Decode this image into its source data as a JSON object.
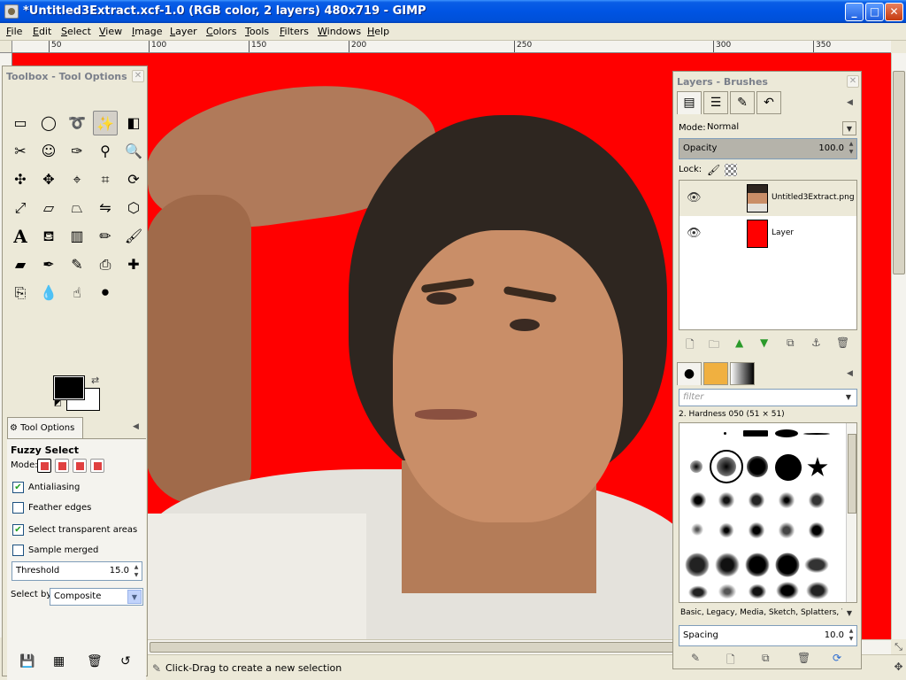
{
  "window": {
    "title": "*Untitled3Extract.xcf-1.0 (RGB color, 2 layers) 480x719 - GIMP",
    "minimize": "_",
    "maximize": "□",
    "close": "✕"
  },
  "menu": [
    "File",
    "Edit",
    "Select",
    "View",
    "Image",
    "Layer",
    "Colors",
    "Tools",
    "Filters",
    "Windows",
    "Help"
  ],
  "ruler": {
    "labels": [
      "50",
      "100",
      "150",
      "200",
      "250",
      "300",
      "350"
    ]
  },
  "status": {
    "message": "Click-Drag to create a new selection"
  },
  "toolbox": {
    "title": "Toolbox - Tool Options",
    "tool_options_tab": "Tool Options",
    "tool_heading": "Fuzzy Select",
    "mode_label": "Mode:",
    "options": [
      {
        "label": "Antialiasing",
        "checked": true
      },
      {
        "label": "Feather edges",
        "checked": false
      },
      {
        "label": "Select transparent areas",
        "checked": true
      },
      {
        "label": "Sample merged",
        "checked": false
      }
    ],
    "threshold_label": "Threshold",
    "threshold_value": "15.0",
    "select_by_label": "Select by:",
    "select_by_value": "Composite",
    "fg_color": "#000000",
    "bg_color": "#ffffff"
  },
  "layers_panel": {
    "title": "Layers - Brushes",
    "mode_label": "Mode:",
    "mode_value": "Normal",
    "opacity_label": "Opacity",
    "opacity_value": "100.0",
    "lock_label": "Lock:",
    "layers": [
      {
        "name": "Untitled3Extract.png",
        "visible": true
      },
      {
        "name": "Layer",
        "visible": true,
        "color": "#ff0000"
      }
    ]
  },
  "brushes_panel": {
    "filter_placeholder": "filter",
    "brush_name": "2. Hardness 050 (51 × 51)",
    "tags": "Basic, Legacy, Media, Sketch, Splatters, Te",
    "spacing_label": "Spacing",
    "spacing_value": "10.0"
  },
  "colors": {
    "canvas_bg": "#ff0000",
    "titlebar": "#0054e3"
  }
}
